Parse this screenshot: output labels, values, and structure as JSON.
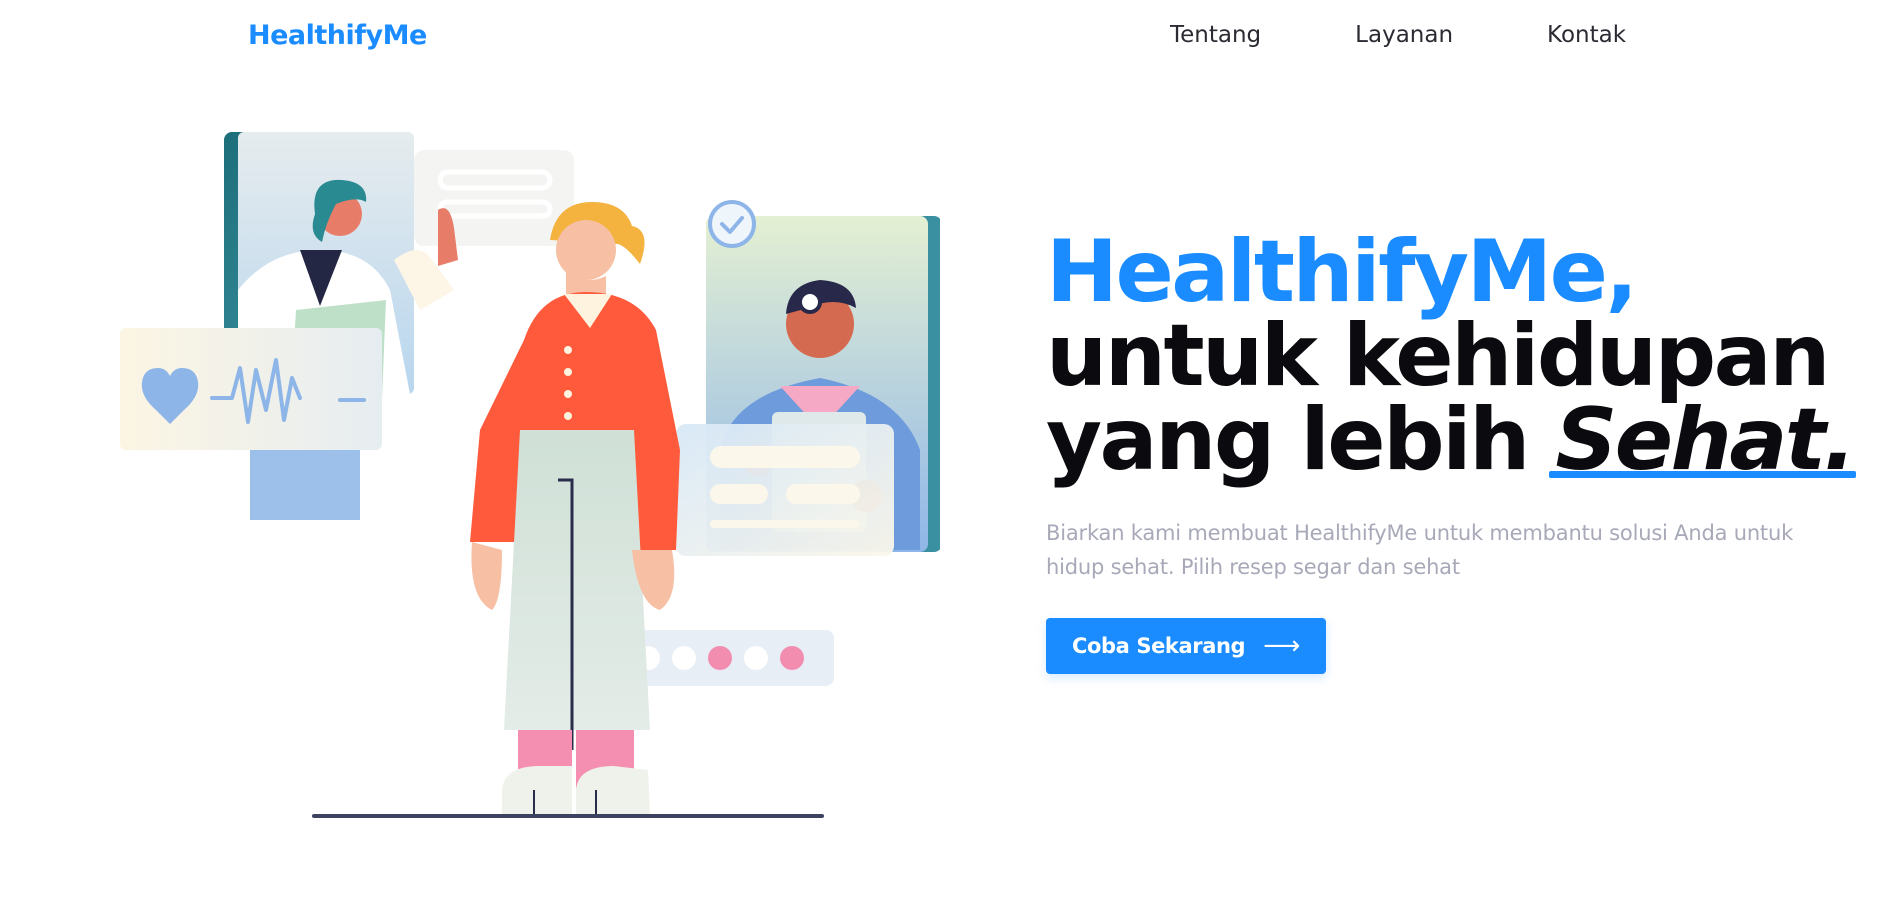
{
  "nav": {
    "brand": "HealthifyMe",
    "links": [
      "Tentang",
      "Layanan",
      "Kontak"
    ]
  },
  "hero": {
    "title_brand": "HealthifyMe,",
    "title_line2": "untuk kehidupan",
    "title_line3_prefix": "yang lebih ",
    "title_emphasis": "Sehat.",
    "subtitle": "Biarkan kami membuat HealthifyMe untuk membantu solusi Anda untuk hidup sehat. Pilih resep segar dan sehat",
    "cta_label": "Coba Sekarang",
    "cta_arrow": "⟶"
  },
  "colors": {
    "accent": "#1a8cff",
    "heading": "#0b0b0f",
    "muted": "#a7a9b8"
  },
  "illustration": {
    "icons": [
      "heart-icon",
      "checkmark-icon",
      "pulse-line-icon"
    ]
  }
}
